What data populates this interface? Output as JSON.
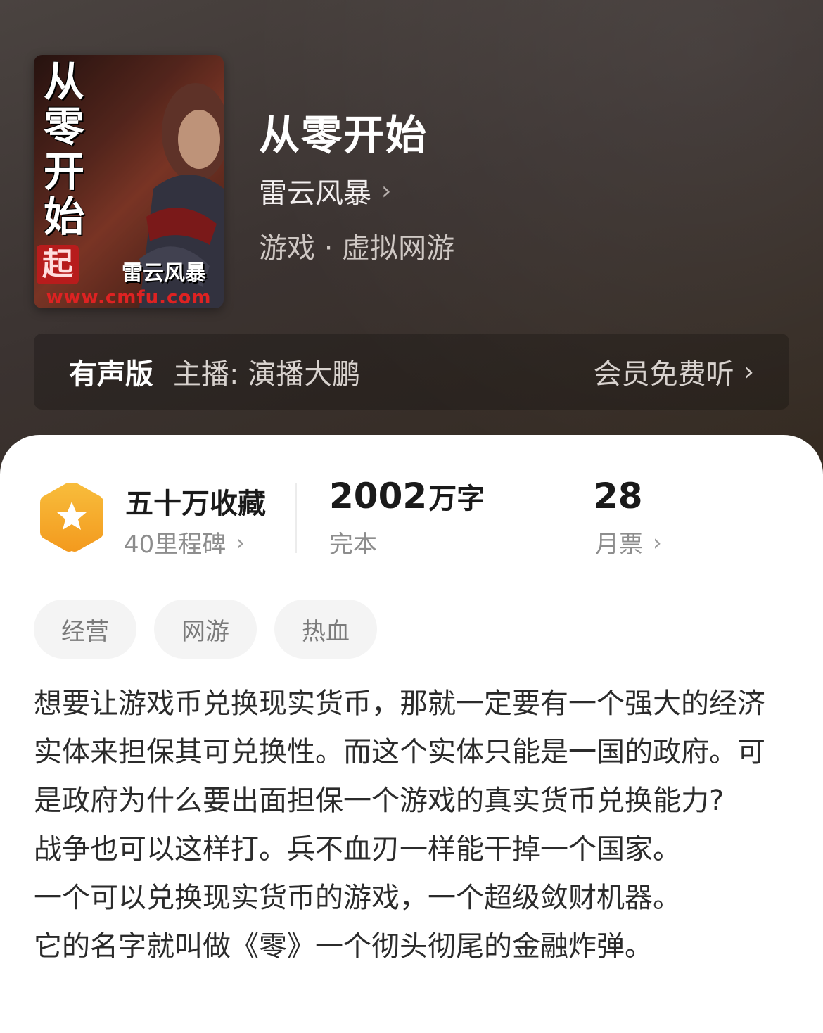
{
  "book": {
    "title": "从零开始",
    "author": "雷云风暴",
    "genre": "游戏 · 虚拟网游"
  },
  "cover": {
    "title_chars": [
      "从",
      "零",
      "开",
      "始"
    ],
    "seal": "起",
    "author_text": "雷云风暴",
    "url": "www.cmfu.com"
  },
  "audio": {
    "label": "有声版",
    "host": "主播: 演播大鹏",
    "free_label": "会员免费听"
  },
  "stats": {
    "collection": {
      "main": "五十万收藏",
      "sub": "40里程碑"
    },
    "words": {
      "number": "2002",
      "unit": "万字",
      "sub": "完本"
    },
    "tickets": {
      "number": "28",
      "sub": "月票"
    }
  },
  "tags": [
    "经营",
    "网游",
    "热血"
  ],
  "description": [
    "想要让游戏币兑换现实货币，那就一定要有一个强大的经济实体来担保其可兑换性。而这个实体只能是一国的政府。可是政府为什么要出面担保一个游戏的真实货币兑换能力?",
    "战争也可以这样打。兵不血刃一样能干掉一个国家。",
    "一个可以兑换现实货币的游戏，一个超级敛财机器。",
    "它的名字就叫做《零》一个彻头彻尾的金融炸弹。"
  ],
  "colors": {
    "badge_fill": "#f5a623",
    "card_bg": "#ffffff",
    "header_bg": "#3b3331"
  }
}
